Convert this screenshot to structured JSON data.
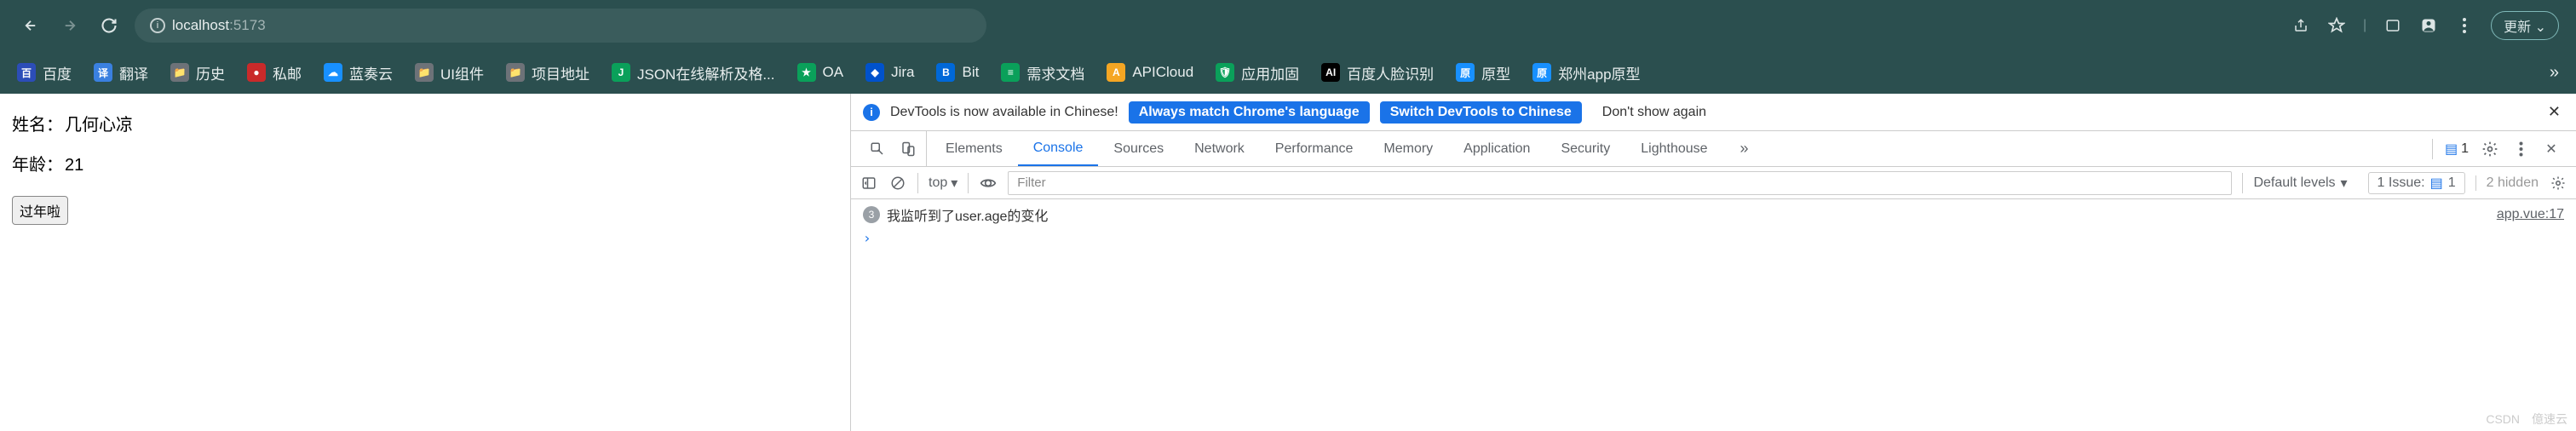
{
  "browser": {
    "host": "localhost",
    "port": ":5173",
    "update_label": "更新",
    "info_char": "i"
  },
  "bookmarks": [
    {
      "label": "百度",
      "color": "#2c4db8",
      "glyph": "百"
    },
    {
      "label": "翻译",
      "color": "#3a80e0",
      "glyph": "译"
    },
    {
      "label": "历史",
      "color": "#6d7278",
      "glyph": "📁"
    },
    {
      "label": "私邮",
      "color": "#c92a2a",
      "glyph": "●"
    },
    {
      "label": "蓝奏云",
      "color": "#1890ff",
      "glyph": "☁"
    },
    {
      "label": "UI组件",
      "color": "#6d7278",
      "glyph": "📁"
    },
    {
      "label": "项目地址",
      "color": "#6d7278",
      "glyph": "📁"
    },
    {
      "label": "JSON在线解析及格...",
      "color": "#0aa05a",
      "glyph": "J"
    },
    {
      "label": "OA",
      "color": "#0aa05a",
      "glyph": "★"
    },
    {
      "label": "Jira",
      "color": "#0052cc",
      "glyph": "◆"
    },
    {
      "label": "Bit",
      "color": "#0068d8",
      "glyph": "B"
    },
    {
      "label": "需求文档",
      "color": "#0aa05a",
      "glyph": "≡"
    },
    {
      "label": "APICloud",
      "color": "#f5a623",
      "glyph": "A"
    },
    {
      "label": "应用加固",
      "color": "#0aa05a",
      "glyph": "🛡"
    },
    {
      "label": "百度人脸识别",
      "color": "#000000",
      "glyph": "AI"
    },
    {
      "label": "原型",
      "color": "#1890ff",
      "glyph": "原"
    },
    {
      "label": "郑州app原型",
      "color": "#1890ff",
      "glyph": "原"
    }
  ],
  "page": {
    "name_label": "姓名：",
    "name_value": "几何心凉",
    "age_label": "年龄：",
    "age_value": "21",
    "button_label": "过年啦"
  },
  "devtools": {
    "infobar": {
      "message": "DevTools is now available in Chinese!",
      "always_match": "Always match Chrome's language",
      "switch_label": "Switch DevTools to Chinese",
      "dont_show": "Don't show again"
    },
    "tabs": [
      "Elements",
      "Console",
      "Sources",
      "Network",
      "Performance",
      "Memory",
      "Application",
      "Security",
      "Lighthouse"
    ],
    "active_tab": "Console",
    "more_glyph": "»",
    "msg_count": "1",
    "console_toolbar": {
      "context": "top",
      "filter_placeholder": "Filter",
      "levels": "Default levels",
      "issue_label": "1 Issue:",
      "issue_count": "1",
      "hidden_label": "2 hidden"
    },
    "console_line": {
      "count": "3",
      "text": "我监听到了user.age的变化",
      "source": "app.vue:17"
    },
    "prompt": "›"
  },
  "watermark": {
    "left": "CSDN",
    "right": "億速云"
  }
}
